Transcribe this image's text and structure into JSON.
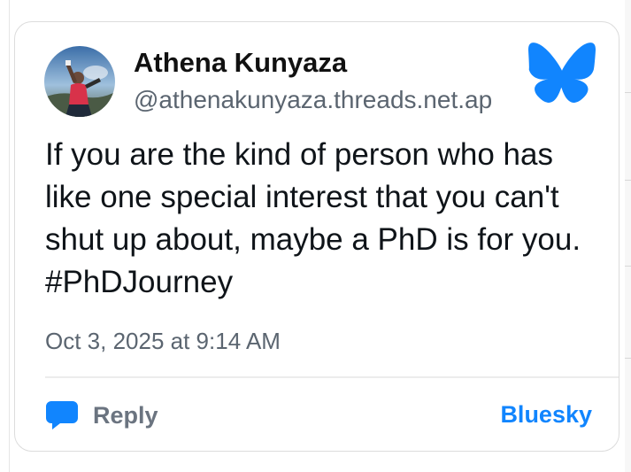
{
  "post": {
    "author": {
      "display_name": "Athena Kunyaza",
      "handle": "@athenakunyaza.threads.net.ap"
    },
    "text_lines": [
      "If you are the kind of person who has",
      "like one special interest that you can't",
      "shut up about, maybe a PhD is for you.",
      "#PhDJourney"
    ],
    "timestamp": "Oct 3, 2025 at 9:14 AM"
  },
  "actions": {
    "reply_label": "Reply",
    "platform_link_label": "Bluesky"
  },
  "icons": {
    "logo": "bluesky-butterfly-icon",
    "reply": "speech-bubble-icon"
  },
  "colors": {
    "brand_blue": "#1185fe",
    "muted_text": "#5b6570",
    "body_text": "#0f1419",
    "card_border": "#dcdcdc"
  }
}
